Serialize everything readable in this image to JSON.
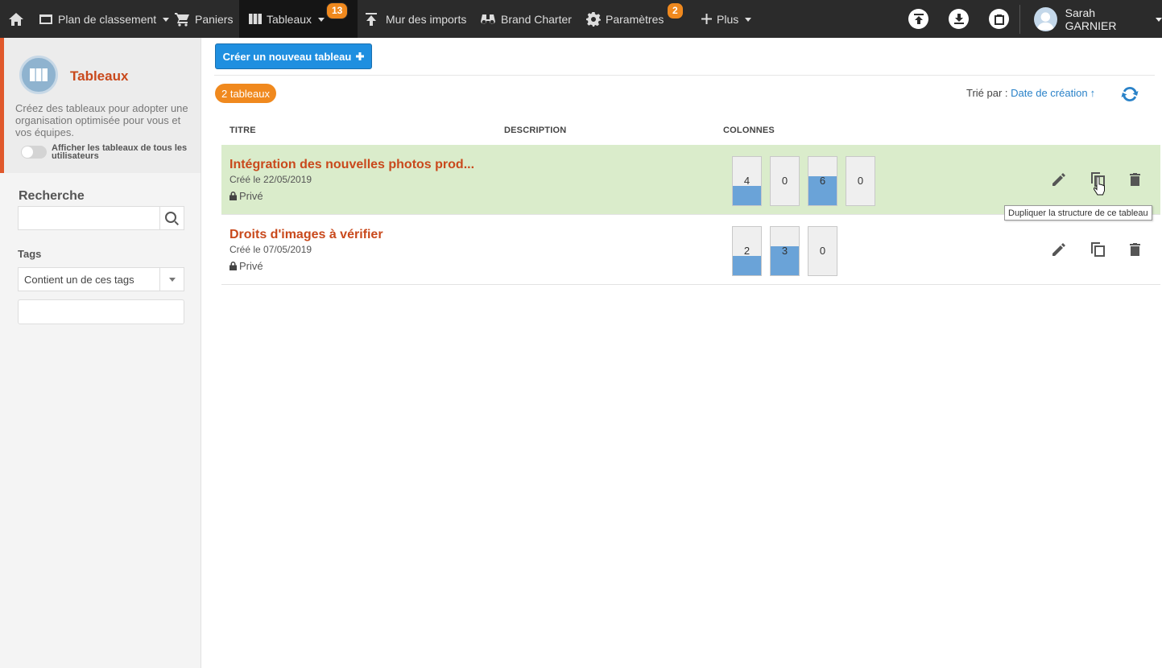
{
  "nav": {
    "plan_label": "Plan de classement",
    "paniers_label": "Paniers",
    "tableaux_label": "Tableaux",
    "tableaux_badge": "13",
    "imports_label": "Mur des imports",
    "brand_label": "Brand Charter",
    "params_label": "Paramètres",
    "params_badge": "2",
    "plus_label": "Plus",
    "user_name": "Sarah GARNIER"
  },
  "sidebar": {
    "title": "Tableaux",
    "description": "Créez des tableaux pour adopter une organisation optimisée pour vous et vos équipes.",
    "toggle_label": "Afficher les tableaux de tous les utilisateurs",
    "search_heading": "Recherche",
    "search_value": "",
    "tags_heading": "Tags",
    "tags_select": "Contient un de ces tags",
    "tags_value": ""
  },
  "main": {
    "create_button": "Créer un nouveau tableau",
    "count_badge": "2 tableaux",
    "sort_prefix": "Trié par :",
    "sort_value": "Date de création",
    "sort_direction": "↑",
    "columns": {
      "title": "TITRE",
      "description": "DESCRIPTION",
      "columns": "COLONNES"
    },
    "rows": [
      {
        "title": "Intégration des nouvelles photos prod...",
        "created": "Créé le 22/05/2019",
        "privacy": "Privé",
        "highlighted": true,
        "columns": [
          {
            "value": "4",
            "fill": 0.4
          },
          {
            "value": "0",
            "fill": 0
          },
          {
            "value": "6",
            "fill": 0.6
          },
          {
            "value": "0",
            "fill": 0
          }
        ]
      },
      {
        "title": "Droits d'images à vérifier",
        "created": "Créé le 07/05/2019",
        "privacy": "Privé",
        "highlighted": false,
        "columns": [
          {
            "value": "2",
            "fill": 0.4
          },
          {
            "value": "3",
            "fill": 0.6
          },
          {
            "value": "0",
            "fill": 0
          }
        ]
      }
    ],
    "tooltip": "Dupliquer la structure de ce tableau"
  },
  "colors": {
    "topbar": "#2b2b2b",
    "accent_orange": "#f0891e",
    "title_red": "#c9491c",
    "link_blue": "#2a82c8",
    "button_blue": "#1f8fe0",
    "row_highlight": "#daeccb",
    "column_fill": "#6aa3d8"
  },
  "icons": [
    "home-icon",
    "folder-icon",
    "cart-icon",
    "columns-icon",
    "upload-icon",
    "binoculars-icon",
    "gear-icon",
    "plus-icon",
    "upload-circle-icon",
    "download-circle-icon",
    "clipboard-icon",
    "avatar-icon",
    "search-icon",
    "lock-icon",
    "pencil-icon",
    "copy-icon",
    "trash-icon",
    "refresh-icon",
    "cursor-icon"
  ]
}
